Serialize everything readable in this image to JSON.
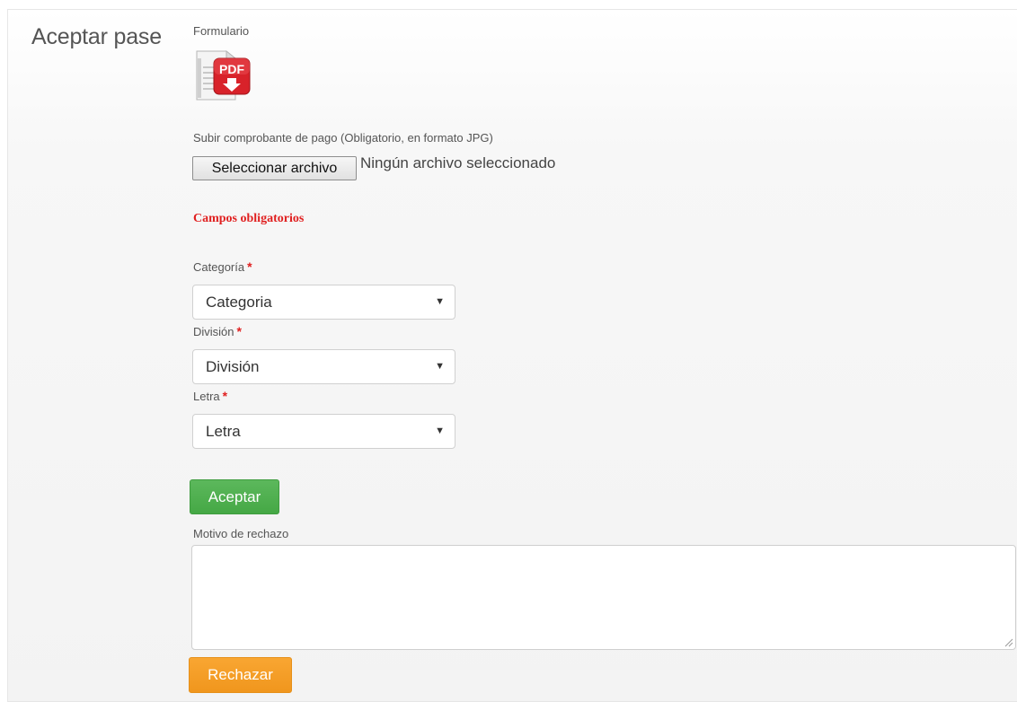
{
  "title": "Aceptar pase",
  "form": {
    "formulario_label": "Formulario",
    "pdf_icon_text": "PDF",
    "upload_label": "Subir comprobante de pago (Obligatorio, en formato JPG)",
    "file_button": "Seleccionar archivo",
    "file_status": "Ningún archivo seleccionado",
    "required_note": "Campos obligatorios",
    "required_marker": "*",
    "categoria": {
      "label": "Categoría",
      "value": "Categoria"
    },
    "division": {
      "label": "División",
      "value": "División"
    },
    "letra": {
      "label": "Letra",
      "value": "Letra"
    },
    "accept_button": "Aceptar",
    "reject_reason_label": "Motivo de rechazo",
    "reject_reason_value": "",
    "reject_button": "Rechazar"
  },
  "icons": {
    "pdf": "pdf-download-icon",
    "dropdown": "chevron-down-icon"
  },
  "colors": {
    "required": "#e02020",
    "accept": "#5cb85c",
    "reject": "#f9a632"
  }
}
